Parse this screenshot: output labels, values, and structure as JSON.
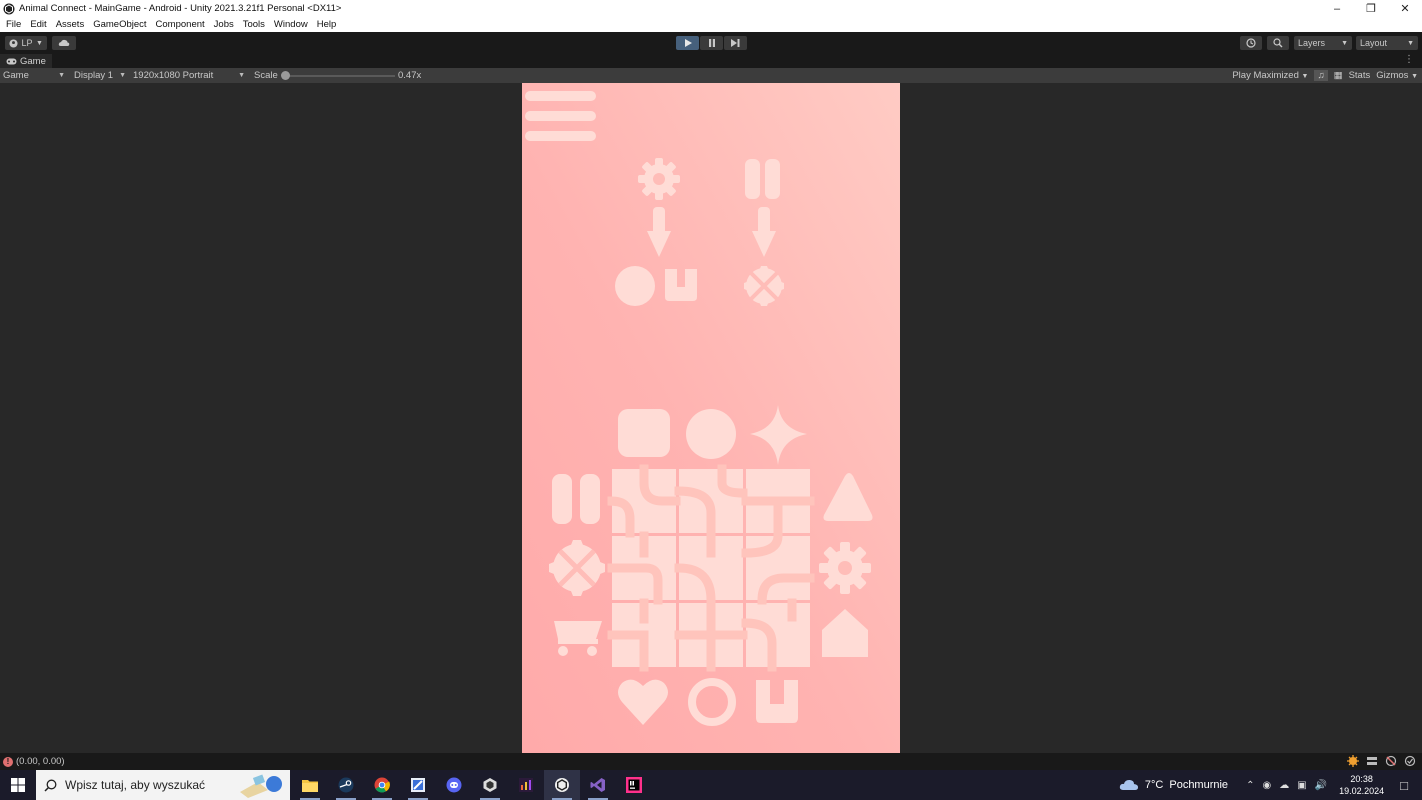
{
  "window": {
    "title": "Animal Connect - MainGame - Android - Unity 2021.3.21f1 Personal <DX11>",
    "controls": [
      "minimize",
      "maximize",
      "close"
    ]
  },
  "menu": {
    "items": [
      "File",
      "Edit",
      "Assets",
      "GameObject",
      "Component",
      "Jobs",
      "Tools",
      "Window",
      "Help"
    ]
  },
  "toolbar": {
    "account_label": "LP",
    "layers_label": "Layers",
    "layout_label": "Layout",
    "play_state": "playing"
  },
  "tabs": {
    "game_label": "Game"
  },
  "game_bar": {
    "view_mode": "Game",
    "display": "Display 1",
    "resolution": "1920x1080 Portrait",
    "scale_label": "Scale",
    "scale_value": "0.47x",
    "scale_fraction": 0.02,
    "play_mode": "Play Maximized",
    "stats_label": "Stats",
    "gizmos_label": "Gizmos"
  },
  "game": {
    "background_top": "#ffcbc4",
    "background_bottom": "#ffaaaa",
    "shape_color": "#ffdcd6"
  },
  "status": {
    "message": "(0.00, 0.00)"
  },
  "taskbar": {
    "search_placeholder": "Wpisz tutaj, aby wyszukać",
    "weather_temp": "7°C",
    "weather_desc": "Pochmurnie",
    "time": "20:38",
    "date": "19.02.2024"
  }
}
